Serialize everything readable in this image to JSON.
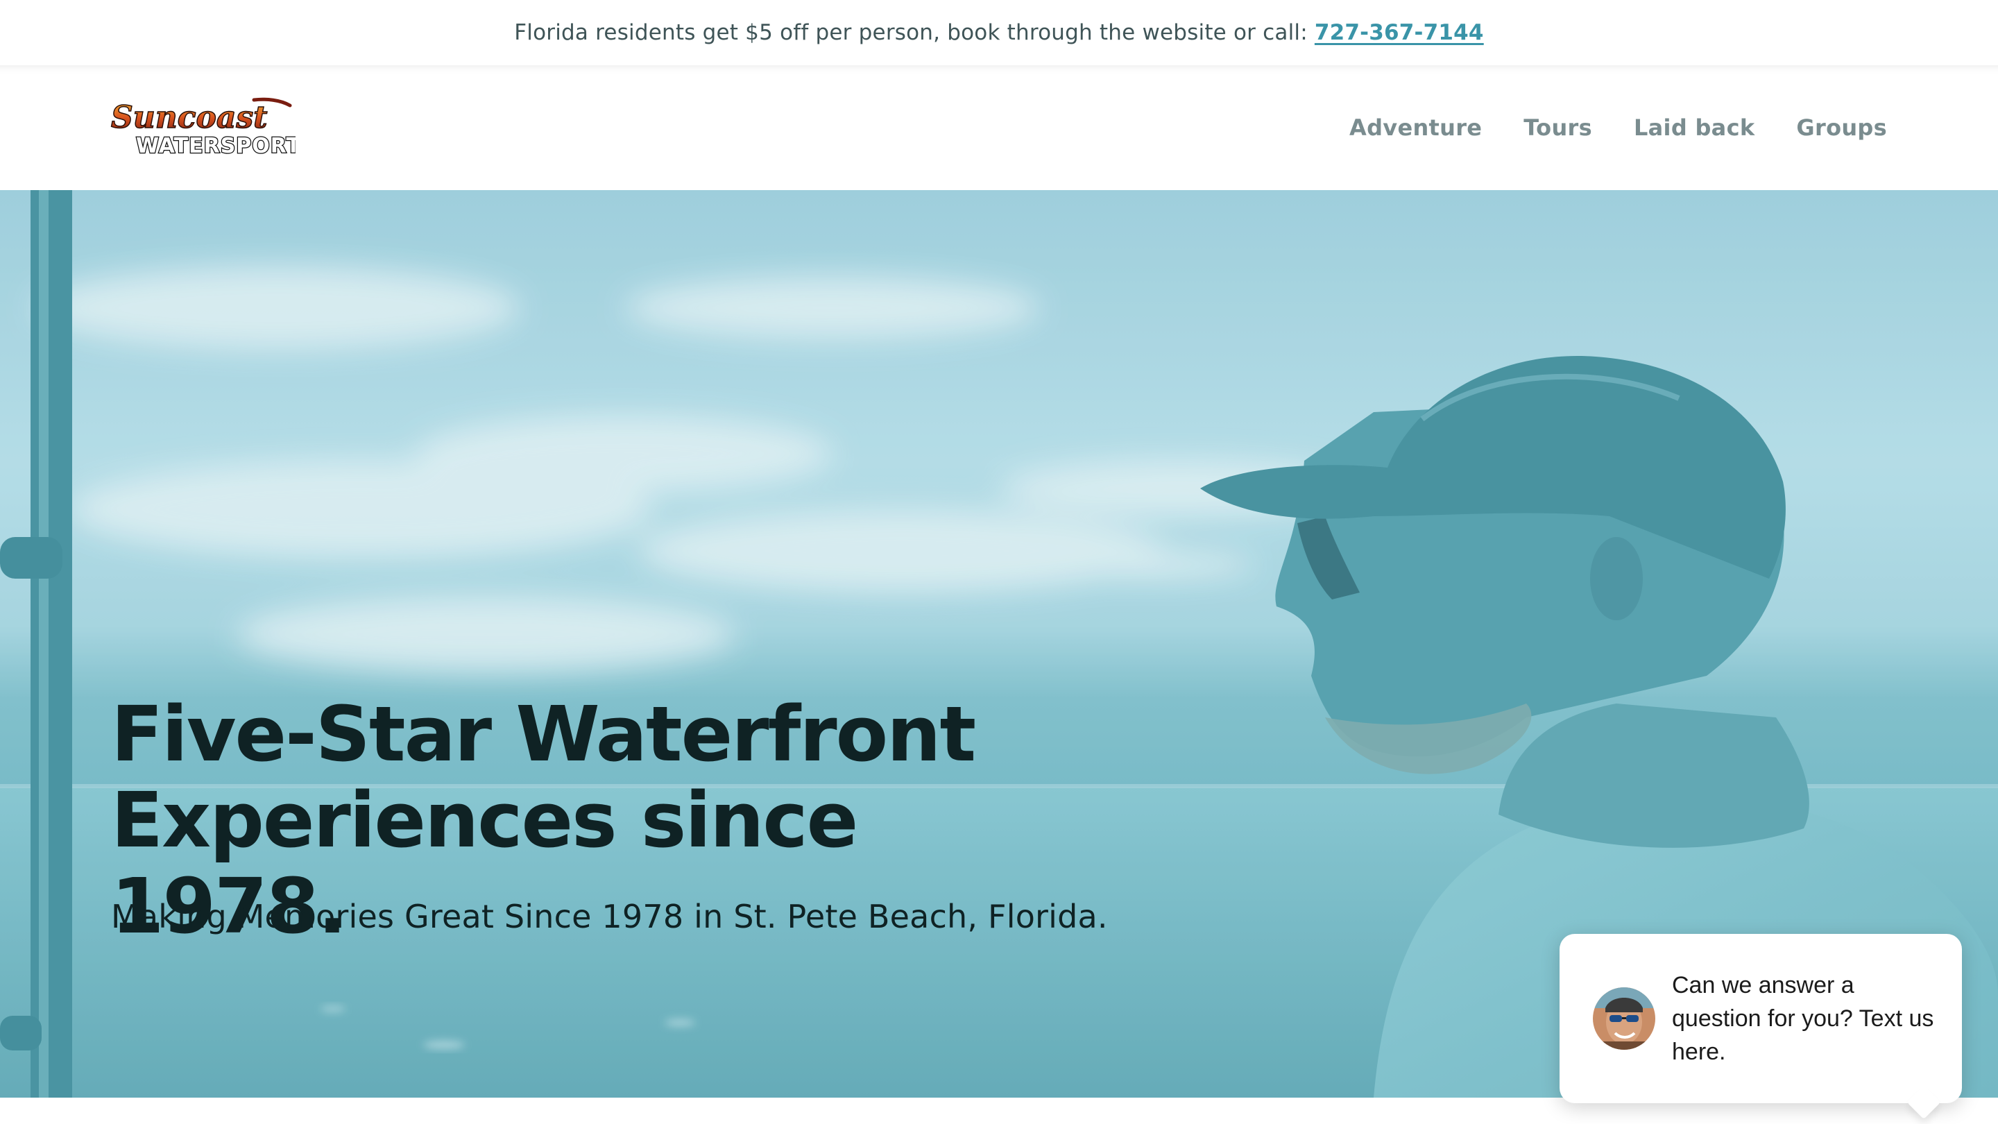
{
  "announcement": {
    "text": "Florida residents get $5 off per person, book through the website or call:",
    "phone": "727-367-7144"
  },
  "brand": {
    "logo_top": "Suncoast",
    "logo_bottom": "WATERSPORTS"
  },
  "nav": {
    "items": [
      {
        "label": "Adventure"
      },
      {
        "label": "Tours"
      },
      {
        "label": "Laid back"
      },
      {
        "label": "Groups"
      }
    ]
  },
  "hero": {
    "title": "Five-Star Waterfront Experiences since 1978.",
    "subtitle": "Making Memories Great Since 1978 in St. Pete Beach, Florida."
  },
  "chat": {
    "message": "Can we answer a question for you? Text us here."
  },
  "colors": {
    "accent": "#3a94a8",
    "hero_tint": "#6bb3bf",
    "heading": "#0f2224",
    "nav": "#7a8c8f"
  }
}
